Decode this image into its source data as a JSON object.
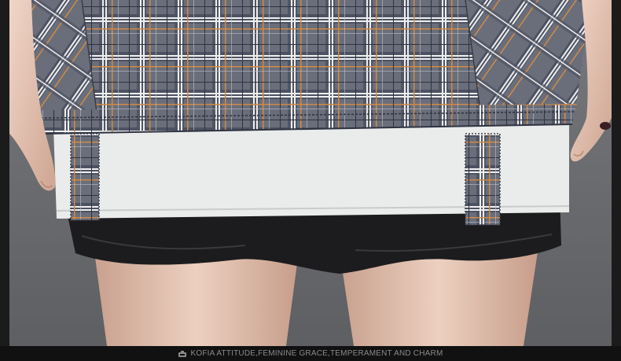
{
  "image": {
    "description_icon": "brand-logo-icon",
    "colors": {
      "background": "#1b1b1b",
      "backdrop": "#6f7173",
      "plaid_base": "#6a6e7a",
      "plaid_navy": "#3c4152",
      "plaid_white": "#efefef",
      "plaid_orange": "#d08a45",
      "white_lining": "#e9ecea",
      "black_shorts": "#1c1c1e",
      "skin": "#e6c3ae"
    }
  },
  "footer": {
    "tagline": "KOFIA ATTITUDE,FEMININE GRACE,TEMPERAMENT AND CHARM"
  }
}
